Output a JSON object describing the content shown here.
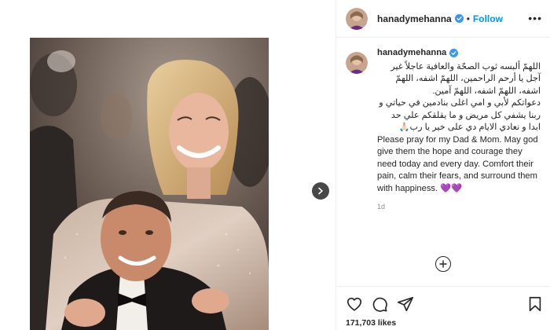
{
  "post": {
    "username": "hanadymehanna",
    "follow_label": "Follow",
    "separator": "•",
    "more_label": "•••",
    "caption_arabic": "اللهمّ ألبسه ثوب الصحّة والعافية عاجلاً غير آجل يا أرحم الراحمين، اللهمّ اشفه، اللهمّ اشفه، اللهمّ اشفه، اللهمّ آمين.",
    "caption_arabic_2": "دعواتكم لأبي و امي اغلى بنادمين في حياتي و ربنا يشفي كل مريض و ما يقلقكم علي حد ابدا و نعادي الايام دي على خير يا رب🙏🏻",
    "caption_english": "Please pray for my Dad & Mom. May god give them the hope and courage they need today and every day. Comfort their pain, calm their fears, and surround them with happiness.",
    "caption_hearts": "💜💜",
    "time_ago": "1d",
    "likes_label": "171,703 likes"
  },
  "icons": {
    "verified": "verified-badge-icon",
    "next": "chevron-right-icon",
    "load_more": "plus-circle-icon",
    "like": "heart-icon",
    "comment": "comment-icon",
    "share": "paper-plane-icon",
    "save": "bookmark-icon"
  },
  "colors": {
    "accent": "#0095f6",
    "text": "#262626",
    "muted": "#8e8e8e",
    "hearts": "#8a2be2"
  }
}
